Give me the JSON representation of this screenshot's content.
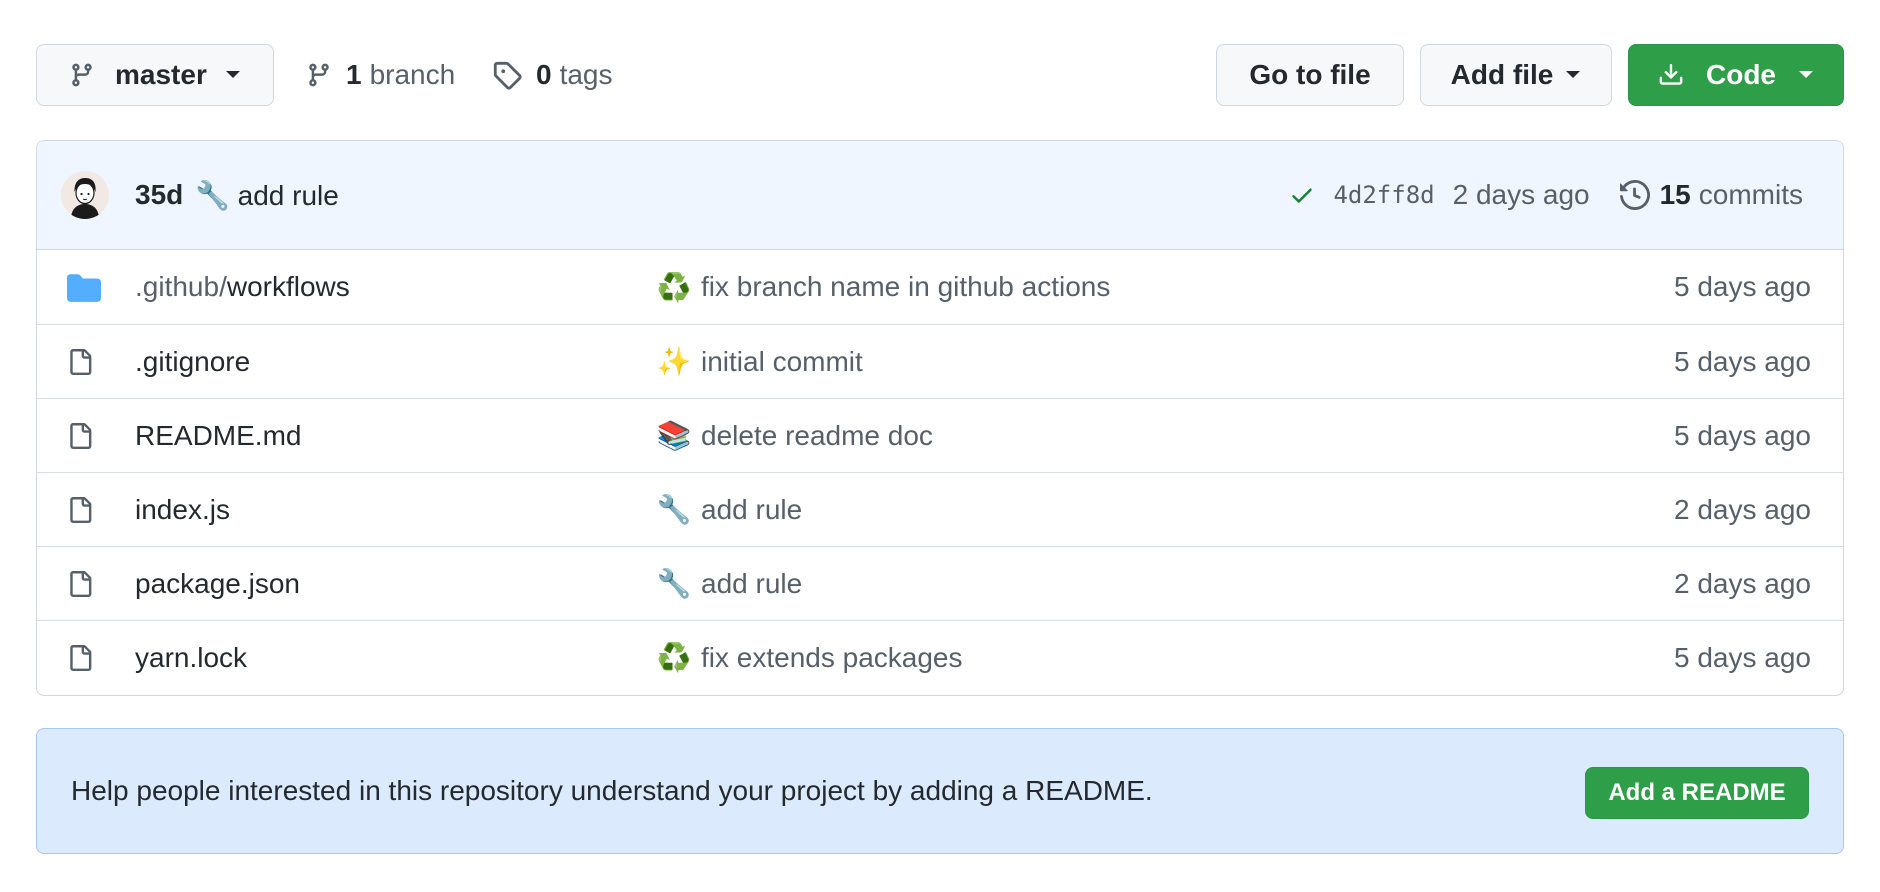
{
  "toolbar": {
    "branch_select": "master",
    "branch_count": "1",
    "branch_label": "branch",
    "tag_count": "0",
    "tag_label": "tags",
    "goto_file": "Go to file",
    "add_file": "Add file",
    "code": "Code"
  },
  "latest_commit": {
    "author": "35d",
    "emoji": "🔧",
    "message": "add rule",
    "sha": "4d2ff8d",
    "time": "2 days ago",
    "commit_count": "15",
    "commits_label": "commits"
  },
  "files": [
    {
      "type": "folder-icon",
      "name_dim": ".github/",
      "name": "workflows",
      "emoji": "♻️",
      "message": "fix branch name in github actions",
      "age": "5 days ago"
    },
    {
      "type": "file-icon",
      "name_dim": "",
      "name": ".gitignore",
      "emoji": "✨",
      "message": "initial commit",
      "age": "5 days ago"
    },
    {
      "type": "file-icon",
      "name_dim": "",
      "name": "README.md",
      "emoji": "📚",
      "message": "delete readme doc",
      "age": "5 days ago"
    },
    {
      "type": "file-icon",
      "name_dim": "",
      "name": "index.js",
      "emoji": "🔧",
      "message": "add rule",
      "age": "2 days ago"
    },
    {
      "type": "file-icon",
      "name_dim": "",
      "name": "package.json",
      "emoji": "🔧",
      "message": "add rule",
      "age": "2 days ago"
    },
    {
      "type": "file-icon",
      "name_dim": "",
      "name": "yarn.lock",
      "emoji": "♻️",
      "message": "fix extends packages",
      "age": "5 days ago"
    }
  ],
  "readme_banner": {
    "text": "Help people interested in this repository understand your project by adding a README.",
    "button": "Add a README"
  },
  "colors": {
    "primary_green": "#2f9e48",
    "check_green": "#1a7f37",
    "folder_blue": "#54aeff",
    "banner_bg": "#dbeafc"
  }
}
